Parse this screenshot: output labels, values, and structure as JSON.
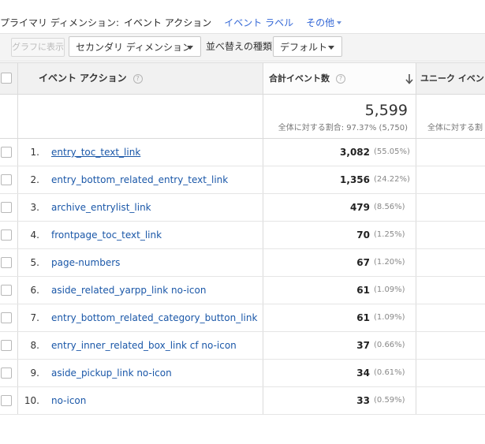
{
  "primary_dimension": {
    "label": "プライマリ ディメンション:",
    "active": "イベント アクション",
    "link": "イベント ラベル",
    "other": "その他"
  },
  "toolbar": {
    "graph_button": "グラフに表示",
    "secondary_dimension": "セカンダリ ディメンション",
    "sort_label": "並べ替えの種類:",
    "sort_value": "デフォルト"
  },
  "columns": {
    "action": "イベント アクション",
    "total_events": "合計イベント数",
    "unique_events": "ユニーク イベン"
  },
  "summary": {
    "total": "5,599",
    "total_share": "全体に対する割合: 97.37% (5,750)",
    "unique_share": "全体に対する割"
  },
  "rows": [
    {
      "num": "1.",
      "name": "entry_toc_text_link",
      "value": "3,082",
      "share": "(55.05%)"
    },
    {
      "num": "2.",
      "name": "entry_bottom_related_entry_text_link",
      "value": "1,356",
      "share": "(24.22%)"
    },
    {
      "num": "3.",
      "name": "archive_entrylist_link",
      "value": "479",
      "share": "(8.56%)"
    },
    {
      "num": "4.",
      "name": "frontpage_toc_text_link",
      "value": "70",
      "share": "(1.25%)"
    },
    {
      "num": "5.",
      "name": "page-numbers",
      "value": "67",
      "share": "(1.20%)"
    },
    {
      "num": "6.",
      "name": "aside_related_yarpp_link no-icon",
      "value": "61",
      "share": "(1.09%)"
    },
    {
      "num": "7.",
      "name": "entry_bottom_related_category_button_link",
      "value": "61",
      "share": "(1.09%)"
    },
    {
      "num": "8.",
      "name": "entry_inner_related_box_link cf no-icon",
      "value": "37",
      "share": "(0.66%)"
    },
    {
      "num": "9.",
      "name": "aside_pickup_link no-icon",
      "value": "34",
      "share": "(0.61%)"
    },
    {
      "num": "10.",
      "name": "no-icon",
      "value": "33",
      "share": "(0.59%)"
    }
  ]
}
